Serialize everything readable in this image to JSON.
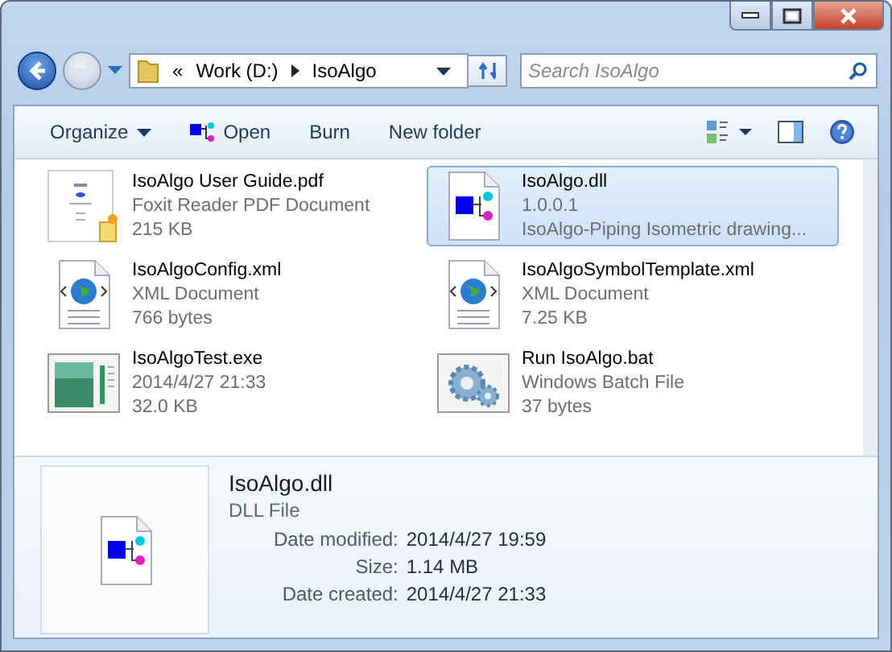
{
  "address": {
    "overflow": "«",
    "breadcrumbs": [
      "Work (D:)",
      "IsoAlgo"
    ]
  },
  "search": {
    "placeholder": "Search IsoAlgo"
  },
  "toolbar": {
    "buttons": [
      {
        "label": "Organize",
        "kind": "menu"
      },
      {
        "label": "Open",
        "kind": "icon"
      },
      {
        "label": "Burn",
        "kind": "plain"
      },
      {
        "label": "New folder",
        "kind": "plain"
      }
    ]
  },
  "files": [
    {
      "name": "IsoAlgo User Guide.pdf",
      "kind": "pdf",
      "line_2": "Foxit Reader PDF Document",
      "line_3": "215 KB",
      "selected": false
    },
    {
      "name": "IsoAlgo.dll",
      "kind": "dll",
      "line_2": "1.0.0.1",
      "line_3": "IsoAlgo-Piping Isometric drawing...",
      "selected": true
    },
    {
      "name": "IsoAlgoConfig.xml",
      "kind": "xml",
      "line_2": "XML Document",
      "line_3": "766 bytes",
      "selected": false
    },
    {
      "name": "IsoAlgoSymbolTemplate.xml",
      "kind": "xml",
      "line_2": "XML Document",
      "line_3": "7.25 KB",
      "selected": false
    },
    {
      "name": "IsoAlgoTest.exe",
      "kind": "exe",
      "line_2": "2014/4/27 21:33",
      "line_3": "32.0 KB",
      "selected": false
    },
    {
      "name": "Run IsoAlgo.bat",
      "kind": "bat",
      "line_2": "Windows Batch File",
      "line_3": "37 bytes",
      "selected": false
    }
  ],
  "details": {
    "kind": "dll",
    "name": "IsoAlgo.dll",
    "type": "DLL File",
    "properties": [
      {
        "label": "Date modified:",
        "value": "2014/4/27 19:59"
      },
      {
        "label": "Size:",
        "value": "1.14 MB"
      },
      {
        "label": "Date created:",
        "value": "2014/4/27 21:33"
      }
    ]
  }
}
